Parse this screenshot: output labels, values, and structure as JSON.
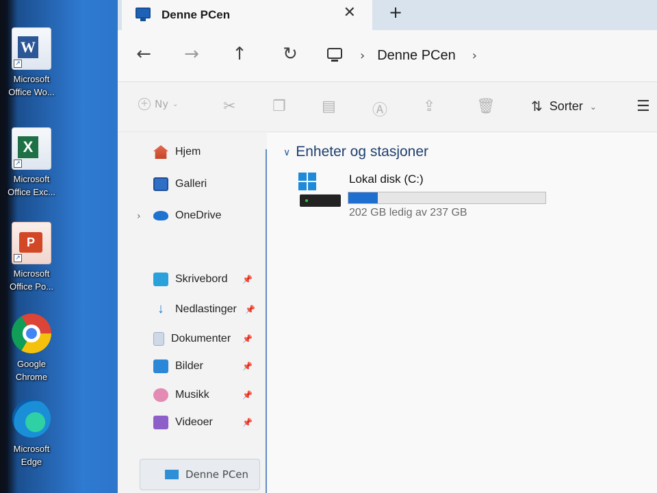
{
  "desktop": {
    "icons": [
      {
        "label": "Microsoft\nOffice Wo...",
        "badge": "W"
      },
      {
        "label": "Microsoft\nOffice Exc...",
        "badge": "X"
      },
      {
        "label": "Microsoft\nOffice Po...",
        "badge": "P"
      },
      {
        "label": "Google\nChrome"
      },
      {
        "label": "Microsoft\nEdge"
      }
    ]
  },
  "window": {
    "tab_title": "Denne PCen",
    "tab_close": "✕",
    "new_tab": "+",
    "breadcrumb": {
      "location": "Denne PCen"
    },
    "toolbar": {
      "new_label": "Ny",
      "sort_label": "Sorter"
    },
    "nav": {
      "items": [
        {
          "label": "Hjem"
        },
        {
          "label": "Galleri"
        },
        {
          "label": "OneDrive"
        },
        {
          "label": "Skrivebord"
        },
        {
          "label": "Nedlastinger"
        },
        {
          "label": "Dokumenter"
        },
        {
          "label": "Bilder"
        },
        {
          "label": "Musikk"
        },
        {
          "label": "Videoer"
        }
      ],
      "footer_label": "Denne PCen"
    },
    "content": {
      "group_title": "Enheter og stasjoner",
      "drive": {
        "name": "Lokal disk (C:)",
        "free_text": "202 GB ledig av 237 GB",
        "used_fraction": 0.148,
        "fill_color": "#1f6fd1"
      }
    }
  }
}
